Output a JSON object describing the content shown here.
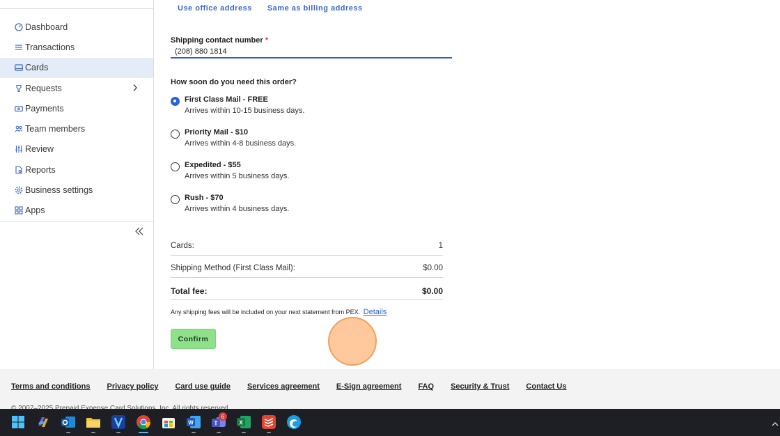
{
  "sidebar": {
    "items": [
      {
        "label": "Dashboard",
        "icon": "dashboard-icon"
      },
      {
        "label": "Transactions",
        "icon": "list-icon"
      },
      {
        "label": "Cards",
        "icon": "card-icon",
        "active": true
      },
      {
        "label": "Requests",
        "icon": "requests-icon",
        "has_chevron": true
      },
      {
        "label": "Payments",
        "icon": "payments-icon"
      },
      {
        "label": "Team members",
        "icon": "team-icon"
      },
      {
        "label": "Review",
        "icon": "sliders-icon"
      },
      {
        "label": "Reports",
        "icon": "reports-icon"
      },
      {
        "label": "Business settings",
        "icon": "gear-icon"
      },
      {
        "label": "Apps",
        "icon": "apps-icon"
      }
    ]
  },
  "address_links": {
    "office": "Use office address",
    "billing": "Same as billing address"
  },
  "phone": {
    "label": "Shipping contact number",
    "required_mark": "*",
    "value": "(208) 880 1814"
  },
  "shipping": {
    "question": "How soon do you need this order?",
    "options": [
      {
        "title": "First Class Mail - FREE",
        "desc": "Arrives within 10-15 business days.",
        "selected": true
      },
      {
        "title": "Priority Mail - $10",
        "desc": "Arrives within 4-8 business days.",
        "selected": false
      },
      {
        "title": "Expedited - $55",
        "desc": "Arrives within 5 business days.",
        "selected": false
      },
      {
        "title": "Rush - $70",
        "desc": "Arrives within 4 business days.",
        "selected": false
      }
    ]
  },
  "summary": {
    "cards_label": "Cards:",
    "cards_value": "1",
    "method_label": "Shipping Method (First Class Mail):",
    "method_value": "$0.00",
    "total_label": "Total fee:",
    "total_value": "$0.00"
  },
  "fee_note": {
    "text": "Any shipping fees will be included on your next statement from PEX.",
    "link": "Details"
  },
  "confirm_label": "Confirm",
  "footer": {
    "links": [
      "Terms and conditions",
      "Privacy policy",
      "Card use guide",
      "Services agreement",
      "E-Sign agreement",
      "FAQ",
      "Security & Trust",
      "Contact Us"
    ],
    "copyright": "© 2007–2025 Prepaid Expense Card Solutions, Inc. All rights reserved."
  },
  "taskbar": {
    "apps": [
      {
        "name": "windows-start-icon"
      },
      {
        "name": "copilot-icon"
      },
      {
        "name": "outlook-icon"
      },
      {
        "name": "file-explorer-icon"
      },
      {
        "name": "visio-icon"
      },
      {
        "name": "chrome-icon",
        "active": true
      },
      {
        "name": "microsoft-store-icon"
      },
      {
        "name": "word-icon"
      },
      {
        "name": "teams-icon",
        "badge": "6"
      },
      {
        "name": "excel-icon"
      },
      {
        "name": "todoist-icon"
      },
      {
        "name": "edge-icon"
      }
    ]
  },
  "colors": {
    "accent": "#3d69c4",
    "radio_selected": "#2b63d9",
    "confirm_button": "#8ee08a",
    "sidebar_active": "#e3ecf7",
    "required": "#d93a3a"
  }
}
